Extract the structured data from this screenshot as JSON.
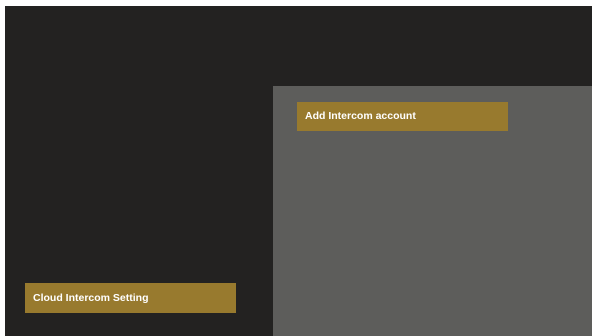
{
  "colors": {
    "background": "#232221",
    "panel": "#5d5d5b",
    "accent": "#987a2e",
    "text": "#ffffff"
  },
  "panel": {
    "add_account_label": "Add Intercom account"
  },
  "menu": {
    "cloud_setting_label": "Cloud Intercom Setting"
  }
}
